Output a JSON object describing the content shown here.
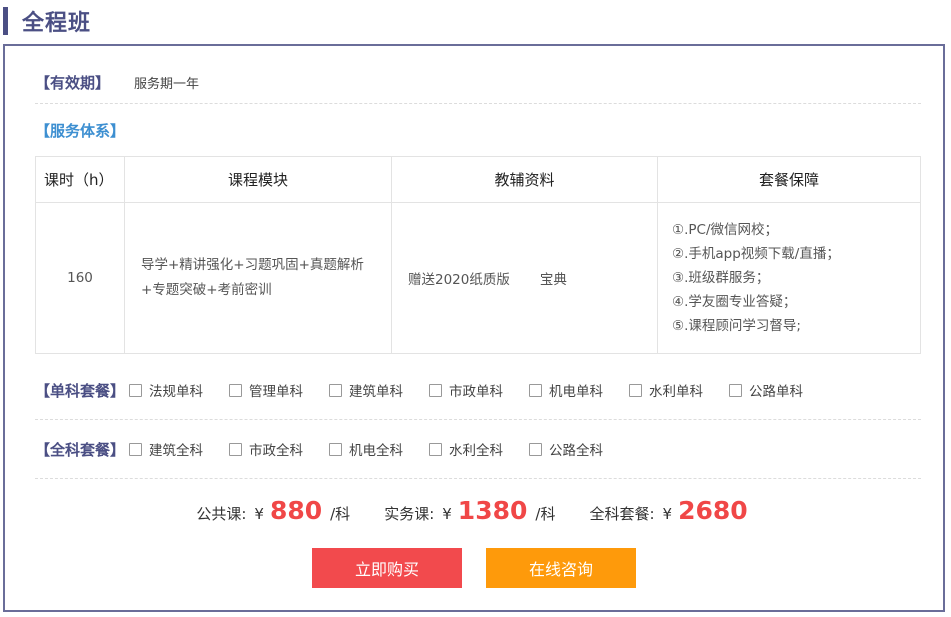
{
  "page": {
    "title": "全程班"
  },
  "validity": {
    "label": "【有效期】",
    "value": "服务期一年"
  },
  "service": {
    "label": "【服务体系】",
    "headers": [
      "课时（h）",
      "课程模块",
      "教辅资料",
      "套餐保障"
    ],
    "row": {
      "hours": "160",
      "module_line1": "导学+精讲强化+习题巩固+真题解析",
      "module_line2": "+专题突破+考前密训",
      "material": "赠送2020纸质版       宝典",
      "guarantees": [
        "①.PC/微信网校；",
        "②.手机app视频下载/直播；",
        "③.班级群服务；",
        "④.学友圈专业答疑；",
        "⑤.课程顾问学习督导;"
      ]
    }
  },
  "single_package": {
    "label": "【单科套餐】",
    "options": [
      "法规单科",
      "管理单科",
      "建筑单科",
      "市政单科",
      "机电单科",
      "水利单科",
      "公路单科"
    ]
  },
  "full_package": {
    "label": "【全科套餐】",
    "options": [
      "建筑全科",
      "市政全科",
      "机电全科",
      "水利全科",
      "公路全科"
    ]
  },
  "pricing": {
    "public_label": "公共课:",
    "public_price": "880",
    "practice_label": "实务课:",
    "practice_price": "1380",
    "full_label": "全科套餐:",
    "full_price": "2680",
    "currency": "¥",
    "unit": "/科"
  },
  "buttons": {
    "buy": "立即购买",
    "consult": "在线咨询"
  },
  "colors": {
    "brand": "#4b4f84",
    "service_label": "#3d8fd1",
    "price": "#f04747",
    "buy_button": "#f24a4d",
    "consult_button": "#fe9a0b"
  }
}
